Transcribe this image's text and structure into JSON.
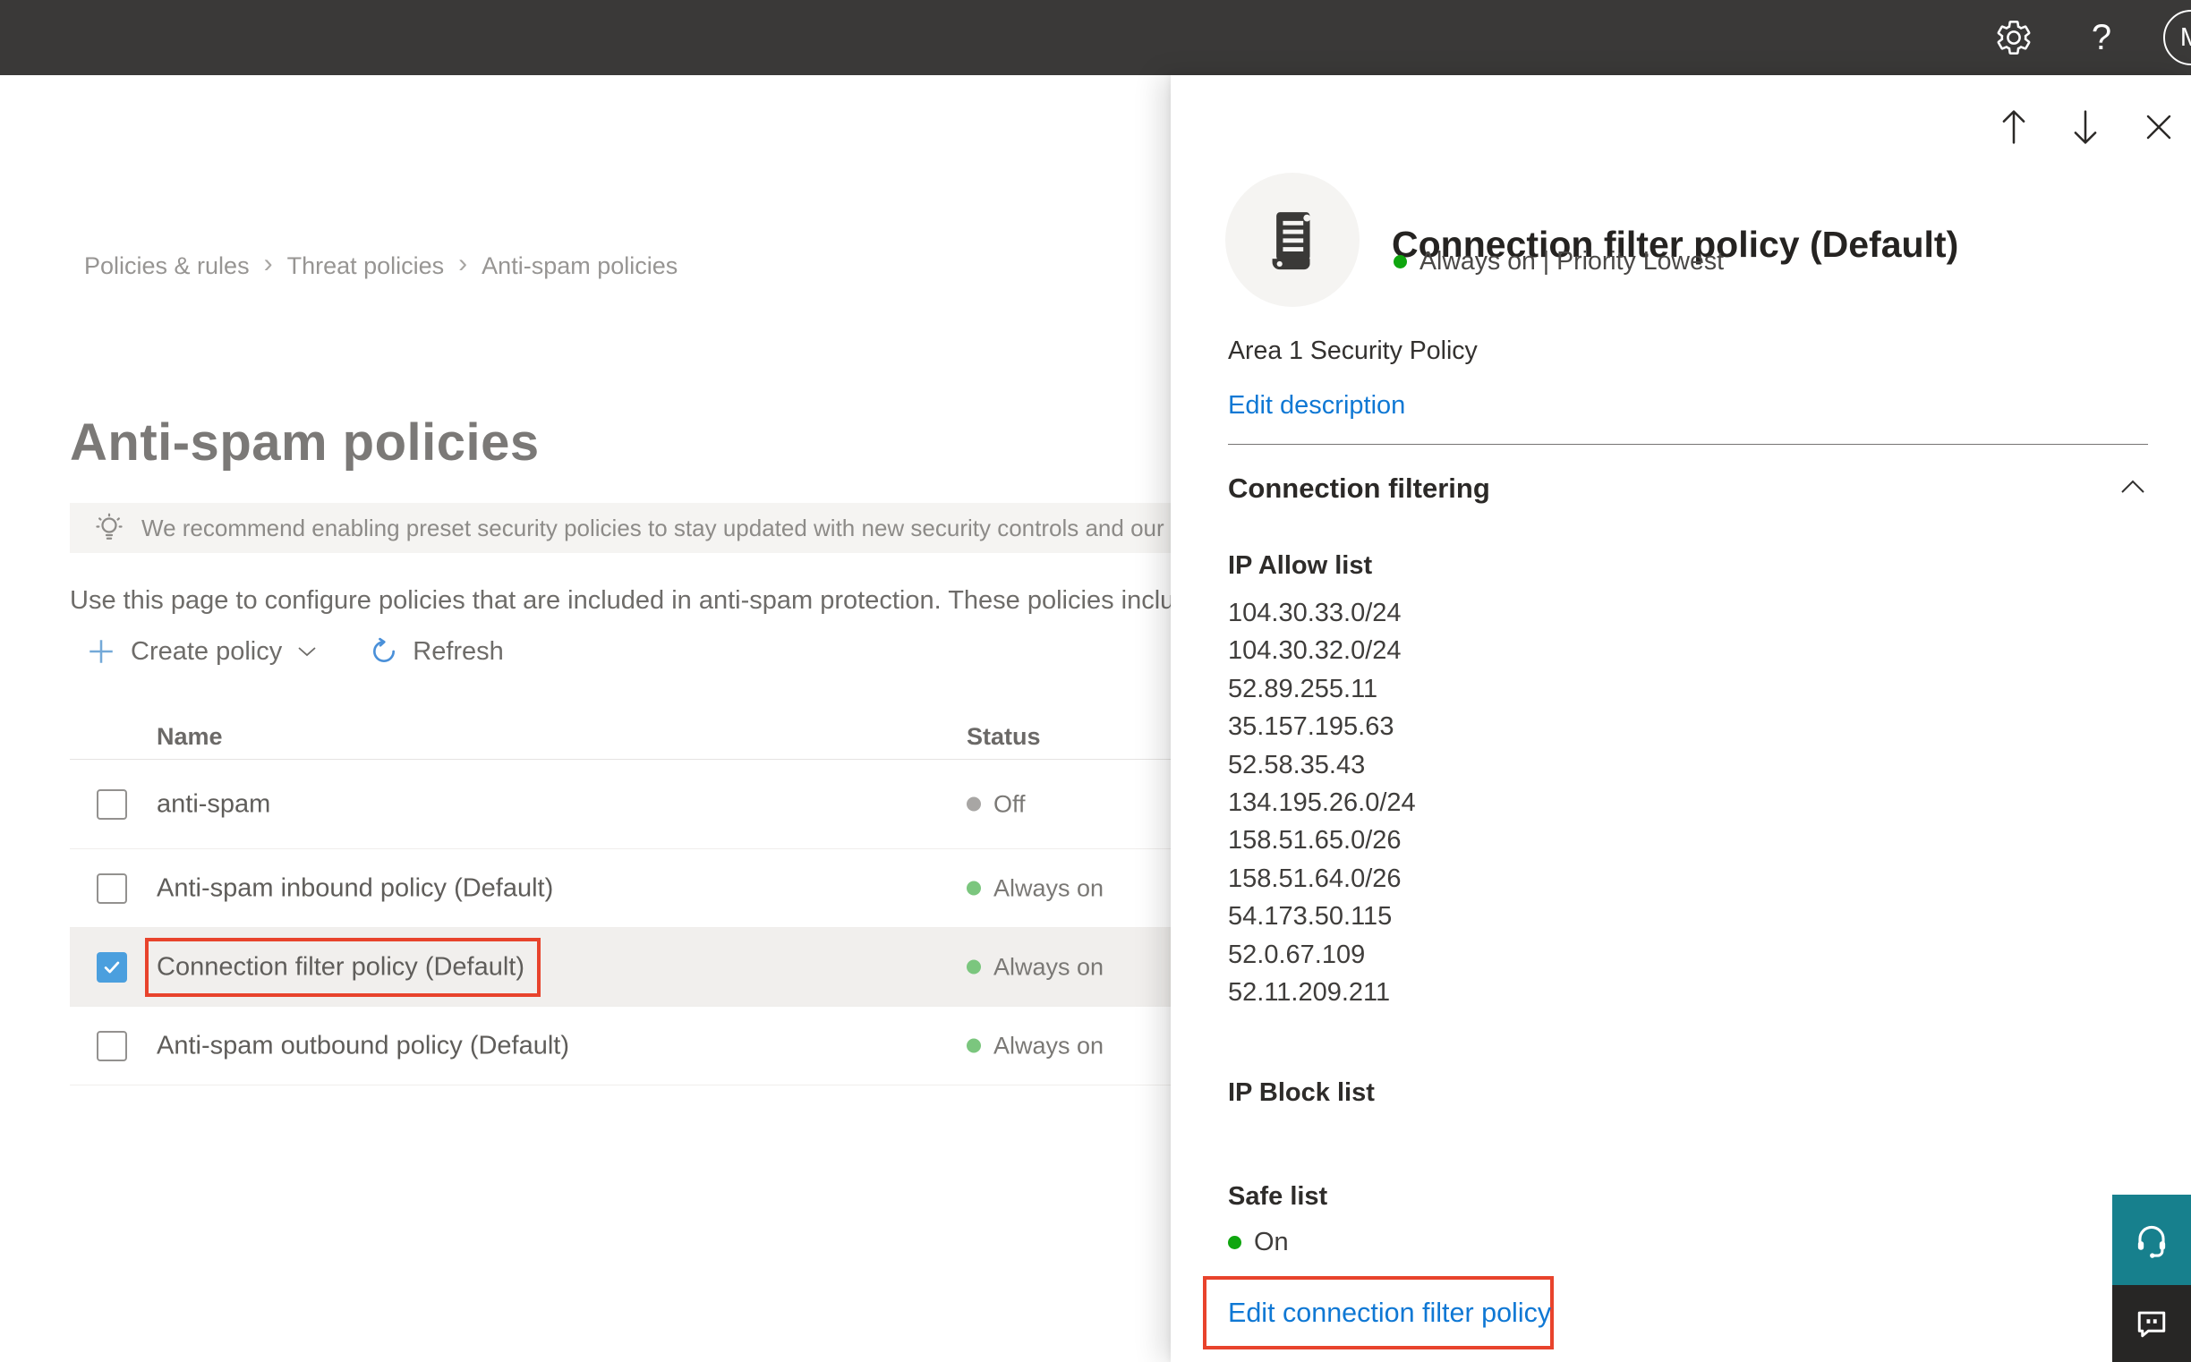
{
  "topbar": {
    "avatar_initial": "M"
  },
  "breadcrumb": {
    "separator": "›",
    "items": [
      "Policies & rules",
      "Threat policies",
      "Anti-spam policies"
    ]
  },
  "main": {
    "title": "Anti-spam policies",
    "banner_text": "We recommend enabling preset security policies to stay updated with new security controls and our recomme",
    "description": "Use this page to configure policies that are included in anti-spam protection. These policies include",
    "toolbar": {
      "create_policy_label": "Create policy",
      "refresh_label": "Refresh"
    },
    "table": {
      "columns": {
        "name": "Name",
        "status": "Status"
      },
      "rows": [
        {
          "name": "anti-spam",
          "status": "Off",
          "checked": false,
          "selected": false
        },
        {
          "name": "Anti-spam inbound policy (Default)",
          "status": "Always on",
          "checked": false,
          "selected": false
        },
        {
          "name": "Connection filter policy (Default)",
          "status": "Always on",
          "checked": true,
          "selected": true
        },
        {
          "name": "Anti-spam outbound policy (Default)",
          "status": "Always on",
          "checked": false,
          "selected": false
        }
      ]
    }
  },
  "flyout": {
    "title": "Connection filter policy (Default)",
    "status_line": "Always on | Priority Lowest",
    "policy_description": "Area 1 Security Policy",
    "edit_description_label": "Edit description",
    "section_title": "Connection filtering",
    "ip_allow_label": "IP Allow list",
    "ip_allow_items": [
      "104.30.33.0/24",
      "104.30.32.0/24",
      "52.89.255.11",
      "35.157.195.63",
      "52.58.35.43",
      "134.195.26.0/24",
      "158.51.65.0/26",
      "158.51.64.0/26",
      "54.173.50.115",
      "52.0.67.109",
      "52.11.209.211"
    ],
    "ip_block_label": "IP Block list",
    "safe_list_label": "Safe list",
    "safe_list_status": "On",
    "edit_link_label": "Edit connection filter policy"
  },
  "colors": {
    "topbar": "#3a3938",
    "accent_blue": "#0f78d4",
    "checkbox_blue": "#4b9fde",
    "status_green_bright": "#0fa60f",
    "status_green_soft": "#7bc67e",
    "status_gray": "#a8a6a4",
    "annotation_red": "#e8432c",
    "corner_teal": "#17808d",
    "corner_dark": "#272625"
  }
}
